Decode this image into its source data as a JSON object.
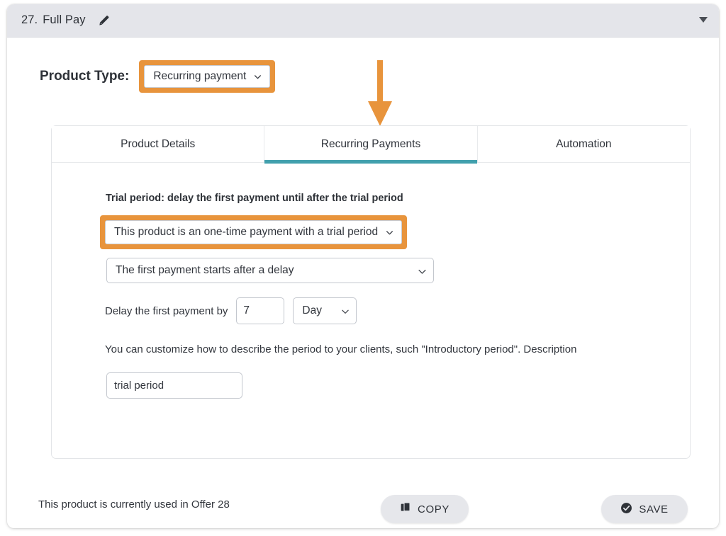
{
  "header": {
    "number": "27.",
    "title": "Full Pay",
    "edit_icon": "pencil-icon",
    "collapse_icon": "caret-down-icon",
    "background_color": "#e4e5ea"
  },
  "product_type": {
    "label": "Product Type:",
    "selected": "Recurring payment",
    "highlighted": true,
    "highlight_color": "#e8943c"
  },
  "annotation": {
    "arrow": "arrow-down-icon",
    "color": "#e8943c",
    "points_to": "Recurring Payments"
  },
  "tabs": [
    {
      "label": "Product Details",
      "active": false
    },
    {
      "label": "Recurring Payments",
      "active": true
    },
    {
      "label": "Automation",
      "active": false
    }
  ],
  "tab_accent_color": "#41a0ad",
  "form": {
    "trial_heading": "Trial period: delay the first payment until after the trial period",
    "trial_type_select": {
      "value": "This product is an one-time payment with a trial period",
      "highlighted": true
    },
    "delay_select": {
      "value": "The first payment starts after a delay"
    },
    "delay_row": {
      "label": "Delay the first payment by",
      "amount": "7",
      "unit": "Day"
    },
    "description_help": "You can customize how to describe the period to your clients, such \"Introductory period\". Description",
    "description_input": {
      "value": "trial period",
      "placeholder": ""
    }
  },
  "footer": {
    "note": "This product is currently used in Offer 28",
    "copy_button": {
      "label": "COPY",
      "icon": "copy-icon"
    },
    "save_button": {
      "label": "SAVE",
      "icon": "check-circle-icon"
    }
  }
}
